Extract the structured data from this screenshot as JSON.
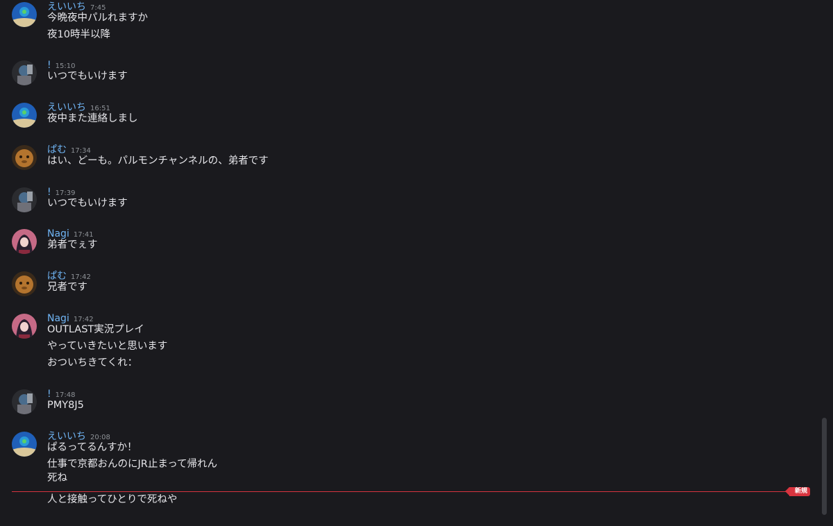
{
  "colors": {
    "background": "#1a1a1e",
    "author_name": "#70b5f5",
    "new_divider": "#d8343f"
  },
  "messages": [
    {
      "author": "えいいち",
      "avatar": "blue-circle-avatar",
      "time": "7:45",
      "lines": [
        "今晩夜中パルれますか",
        "夜10時半以降"
      ]
    },
    {
      "author": "!",
      "avatar": "dark-photo-avatar",
      "time": "15:10",
      "lines": [
        "いつでもいけます"
      ]
    },
    {
      "author": "えいいち",
      "avatar": "blue-circle-avatar",
      "time": "16:51",
      "lines": [
        "夜中また連絡しまし"
      ]
    },
    {
      "author": "ぱむ",
      "avatar": "brown-face-avatar",
      "time": "17:34",
      "lines": [
        "はい、どーも。パルモンチャンネルの、弟者です"
      ]
    },
    {
      "author": "!",
      "avatar": "dark-photo-avatar",
      "time": "17:39",
      "lines": [
        "いつでもいけます"
      ]
    },
    {
      "author": "Nagi",
      "avatar": "anime-girl-avatar",
      "time": "17:41",
      "lines": [
        "弟者でぇす"
      ]
    },
    {
      "author": "ぱむ",
      "avatar": "brown-face-avatar",
      "time": "17:42",
      "lines": [
        "兄者です"
      ]
    },
    {
      "author": "Nagi",
      "avatar": "anime-girl-avatar",
      "time": "17:42",
      "lines": [
        "OUTLAST実況プレイ",
        "やっていきたいと思います",
        "おついちきてくれ："
      ]
    },
    {
      "author": "!",
      "avatar": "dark-photo-avatar",
      "time": "17:48",
      "lines": [
        "PMY8J5"
      ]
    },
    {
      "author": "えいいち",
      "avatar": "blue-circle-avatar",
      "time": "20:08",
      "lines": [
        "ぱるってるんすか！",
        "仕事で京都おんのにJR止まって帰れん",
        "死ね",
        "人と接触ってひとりで死ねや"
      ]
    }
  ],
  "new_badge": "新規"
}
